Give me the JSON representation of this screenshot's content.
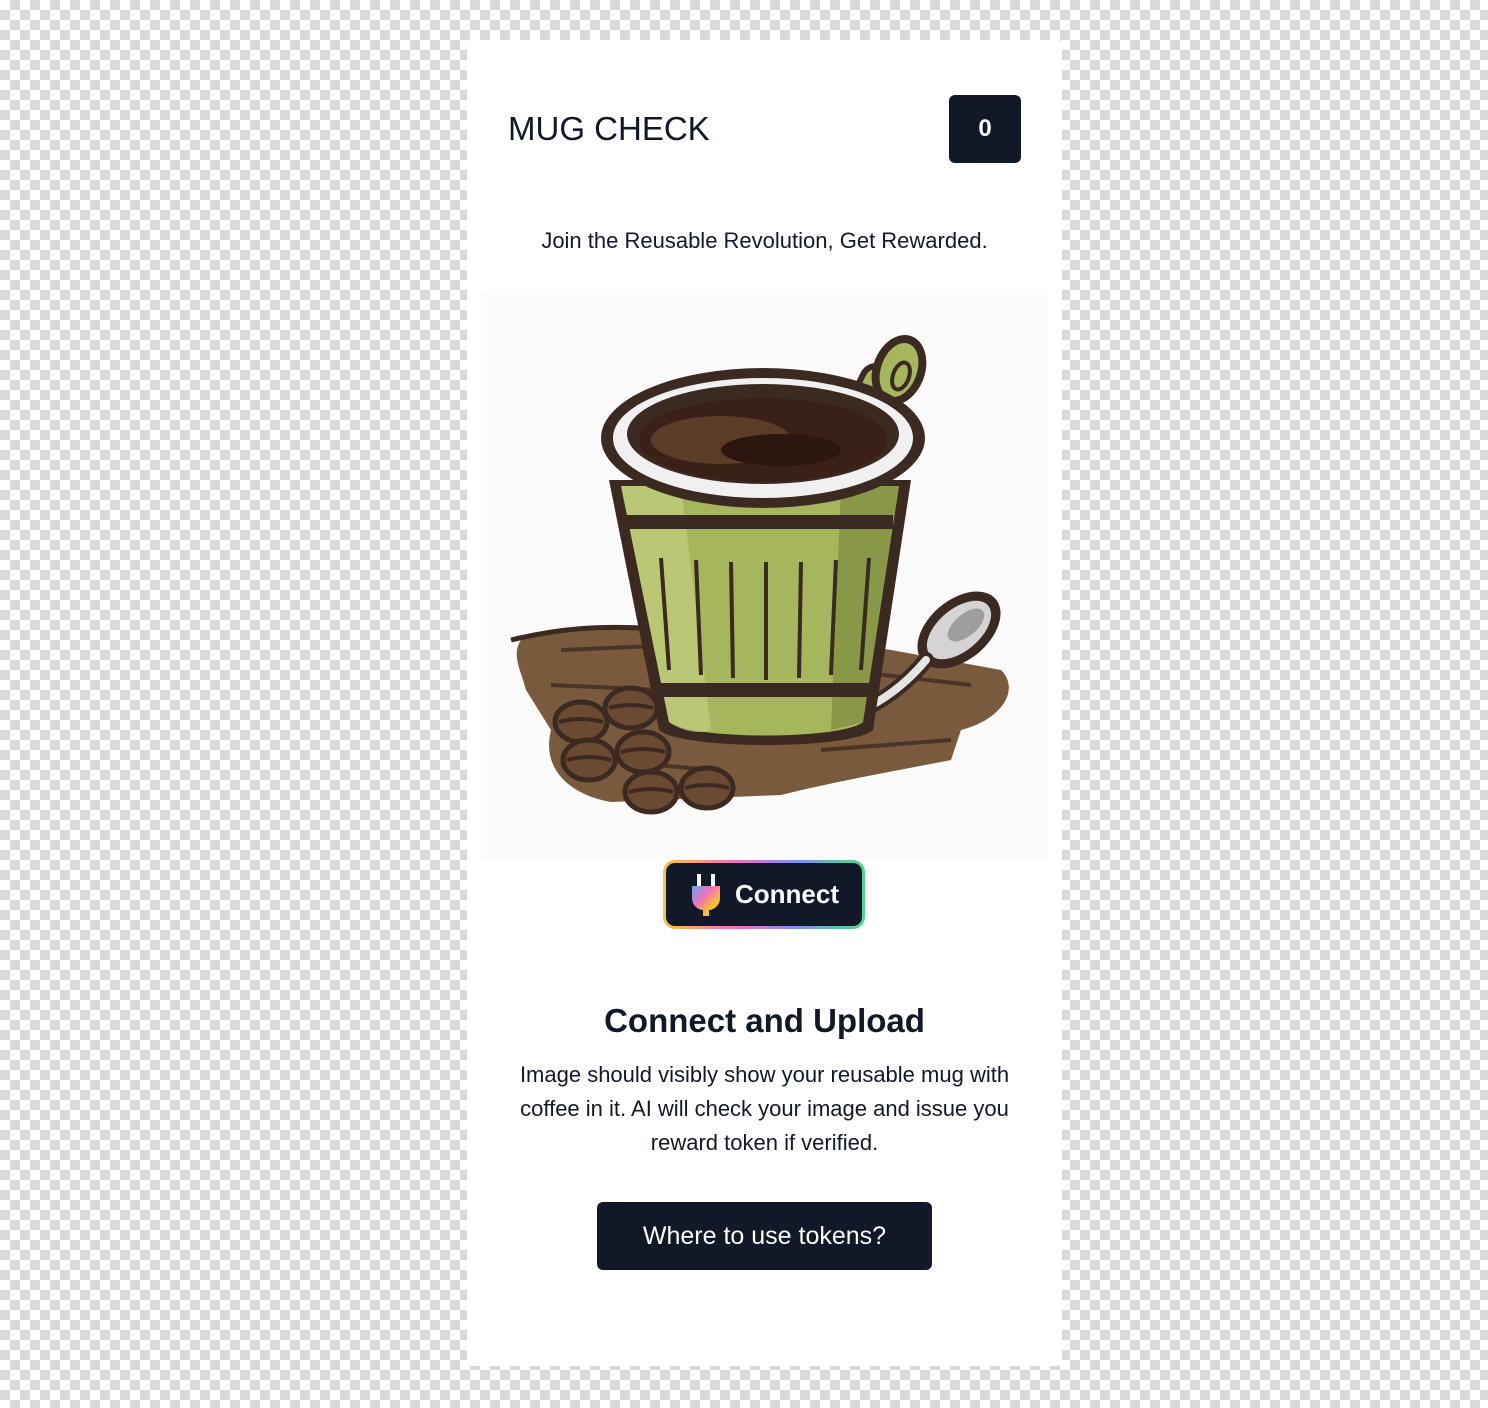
{
  "header": {
    "brand": "MUG CHECK",
    "token_count": "0"
  },
  "tagline": "Join the Reusable Revolution, Get Rewarded.",
  "hero": {
    "icon": "coffee-cup-illustration-icon",
    "colors": {
      "cup_green": "#a6b65c",
      "outline": "#3b2a22",
      "coffee": "#3a2118",
      "table": "#7a5a3c"
    }
  },
  "connect_button": {
    "label": "Connect",
    "icon": "plug-icon"
  },
  "section": {
    "title": "Connect and Upload",
    "description": "Image should visibly show your reusable mug with coffee in it. AI will check your image and issue you reward token if verified."
  },
  "cta": {
    "label": "Where to use tokens?"
  },
  "colors": {
    "primary_dark": "#111827",
    "card_background": "#ffffff"
  }
}
